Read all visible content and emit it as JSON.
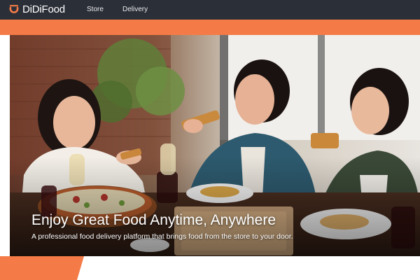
{
  "brand": {
    "name_prefix": "DiDi",
    "name_suffix": "Food",
    "accent_color": "#f47b47",
    "nav_bg": "#2b2f38"
  },
  "nav": {
    "items": [
      {
        "label": "Store"
      },
      {
        "label": "Delivery"
      }
    ]
  },
  "hero": {
    "image": "three women laughing and eating pizza at a restaurant table",
    "headline": "Enjoy Great Food Anytime, Anywhere",
    "subheadline": "A professional food delivery platform that brings food from the store to your door."
  }
}
